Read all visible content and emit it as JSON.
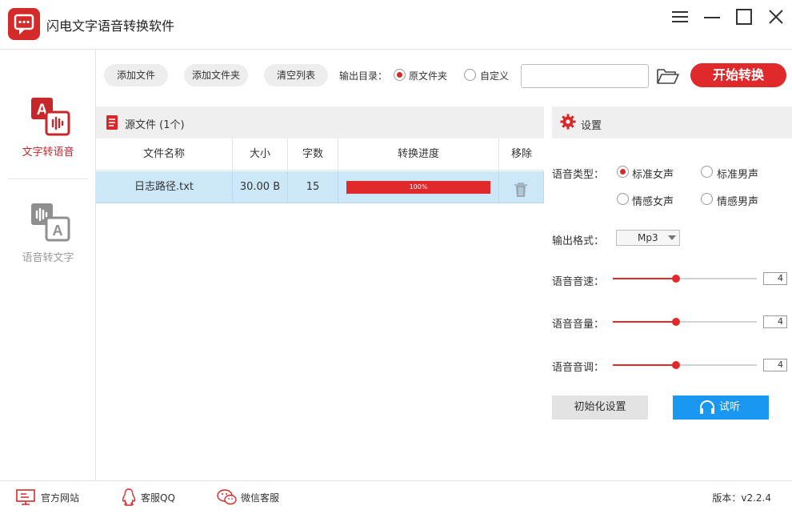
{
  "app": {
    "title": "闪电文字语音转换软件"
  },
  "sidebar": {
    "items": [
      {
        "label": "文字转语音",
        "icon": "text-to-speech-icon",
        "active": true
      },
      {
        "label": "语音转文字",
        "icon": "speech-to-text-icon",
        "active": false
      }
    ]
  },
  "toolbar": {
    "add_file": "添加文件",
    "add_folder": "添加文件夹",
    "clear_list": "清空列表",
    "output_dir_label": "输出目录：",
    "output_options": [
      {
        "label": "原文件夹",
        "selected": true
      },
      {
        "label": "自定义",
        "selected": false
      }
    ],
    "path_value": "",
    "start": "开始转换"
  },
  "files": {
    "header_title": "源文件 (1个)",
    "columns": [
      "文件名称",
      "大小",
      "字数",
      "转换进度",
      "移除"
    ],
    "rows": [
      {
        "name": "日志路径.txt",
        "size": "30.00 B",
        "chars": "15",
        "progress": 1.0,
        "progress_label": "100%"
      }
    ]
  },
  "settings": {
    "title": "设置",
    "voice_type_label": "语音类型：",
    "voice_options": [
      {
        "label": "标准女声",
        "selected": true
      },
      {
        "label": "标准男声",
        "selected": false
      },
      {
        "label": "情感女声",
        "selected": false
      },
      {
        "label": "情感男声",
        "selected": false
      }
    ],
    "format_label": "输出格式：",
    "format_value": "Mp3",
    "sliders": [
      {
        "label": "语音音速：",
        "value": "4",
        "level": 0.44
      },
      {
        "label": "语音音量：",
        "value": "4",
        "level": 0.44
      },
      {
        "label": "语音音调：",
        "value": "4",
        "level": 0.44
      }
    ],
    "reset": "初始化设置",
    "listen": "试听"
  },
  "footer": {
    "website": "官方网站",
    "qq": "客服QQ",
    "wechat": "微信客服",
    "version": "版本：v2.2.4"
  },
  "colors": {
    "accent": "#e0292b",
    "blue": "#1a97f0",
    "row_selected": "#cce7f8"
  }
}
